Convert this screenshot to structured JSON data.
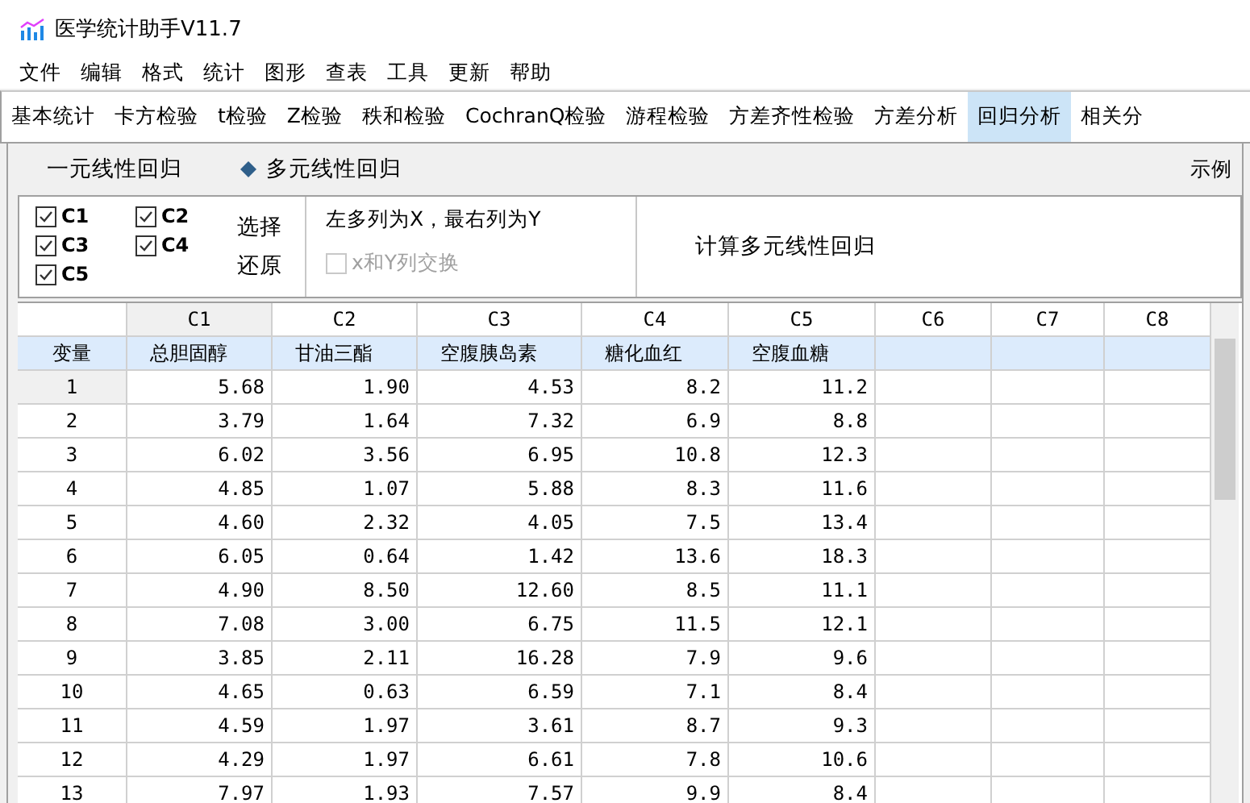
{
  "window": {
    "title": "医学统计助手V11.7"
  },
  "menu": [
    "文件",
    "编辑",
    "格式",
    "统计",
    "图形",
    "查表",
    "工具",
    "更新",
    "帮助"
  ],
  "tabs": [
    {
      "label": "基本统计",
      "selected": false
    },
    {
      "label": "卡方检验",
      "selected": false
    },
    {
      "label": "t检验",
      "selected": false
    },
    {
      "label": "Z检验",
      "selected": false
    },
    {
      "label": "秩和检验",
      "selected": false
    },
    {
      "label": "CochranQ检验",
      "selected": false
    },
    {
      "label": "游程检验",
      "selected": false
    },
    {
      "label": "方差齐性检验",
      "selected": false
    },
    {
      "label": "方差分析",
      "selected": false
    },
    {
      "label": "回归分析",
      "selected": true
    },
    {
      "label": "相关分",
      "selected": false
    }
  ],
  "subtabs": [
    {
      "label": "一元线性回归",
      "selected": false
    },
    {
      "label": "多元线性回归",
      "selected": true
    }
  ],
  "example_link": "示例",
  "columns_pick": [
    {
      "label": "C1",
      "checked": true
    },
    {
      "label": "C2",
      "checked": true
    },
    {
      "label": "C3",
      "checked": true
    },
    {
      "label": "C4",
      "checked": true
    },
    {
      "label": "C5",
      "checked": true
    }
  ],
  "select_button": "选择",
  "restore_button": "还原",
  "hint": "左多列为X，最右列为Y",
  "swap": {
    "label": "x和Y列交换",
    "checked": false,
    "disabled": true
  },
  "compute_button": "计算多元线性回归",
  "grid": {
    "columns": [
      {
        "label": "C1",
        "selected": true
      },
      {
        "label": "C2",
        "selected": false
      },
      {
        "label": "C3",
        "selected": false
      },
      {
        "label": "C4",
        "selected": false
      },
      {
        "label": "C5",
        "selected": false
      },
      {
        "label": "C6",
        "selected": false
      },
      {
        "label": "C7",
        "selected": false
      },
      {
        "label": "C8",
        "selected": false
      }
    ],
    "variable_label": "变量",
    "variables": [
      "总胆固醇",
      "甘油三酯",
      "空腹胰岛素",
      "糖化血红",
      "空腹血糖"
    ],
    "rows": [
      {
        "label": "1",
        "selected": true,
        "cells": [
          "5.68",
          "1.90",
          "4.53",
          "8.2",
          "11.2"
        ]
      },
      {
        "label": "2",
        "selected": false,
        "cells": [
          "3.79",
          "1.64",
          "7.32",
          "6.9",
          "8.8"
        ]
      },
      {
        "label": "3",
        "selected": false,
        "cells": [
          "6.02",
          "3.56",
          "6.95",
          "10.8",
          "12.3"
        ]
      },
      {
        "label": "4",
        "selected": false,
        "cells": [
          "4.85",
          "1.07",
          "5.88",
          "8.3",
          "11.6"
        ]
      },
      {
        "label": "5",
        "selected": false,
        "cells": [
          "4.60",
          "2.32",
          "4.05",
          "7.5",
          "13.4"
        ]
      },
      {
        "label": "6",
        "selected": false,
        "cells": [
          "6.05",
          "0.64",
          "1.42",
          "13.6",
          "18.3"
        ]
      },
      {
        "label": "7",
        "selected": false,
        "cells": [
          "4.90",
          "8.50",
          "12.60",
          "8.5",
          "11.1"
        ]
      },
      {
        "label": "8",
        "selected": false,
        "cells": [
          "7.08",
          "3.00",
          "6.75",
          "11.5",
          "12.1"
        ]
      },
      {
        "label": "9",
        "selected": false,
        "cells": [
          "3.85",
          "2.11",
          "16.28",
          "7.9",
          "9.6"
        ]
      },
      {
        "label": "10",
        "selected": false,
        "cells": [
          "4.65",
          "0.63",
          "6.59",
          "7.1",
          "8.4"
        ]
      },
      {
        "label": "11",
        "selected": false,
        "cells": [
          "4.59",
          "1.97",
          "3.61",
          "8.7",
          "9.3"
        ]
      },
      {
        "label": "12",
        "selected": false,
        "cells": [
          "4.29",
          "1.97",
          "6.61",
          "7.8",
          "10.6"
        ]
      },
      {
        "label": "13",
        "selected": false,
        "cells": [
          "7.97",
          "1.93",
          "7.57",
          "9.9",
          "8.4"
        ]
      }
    ]
  }
}
